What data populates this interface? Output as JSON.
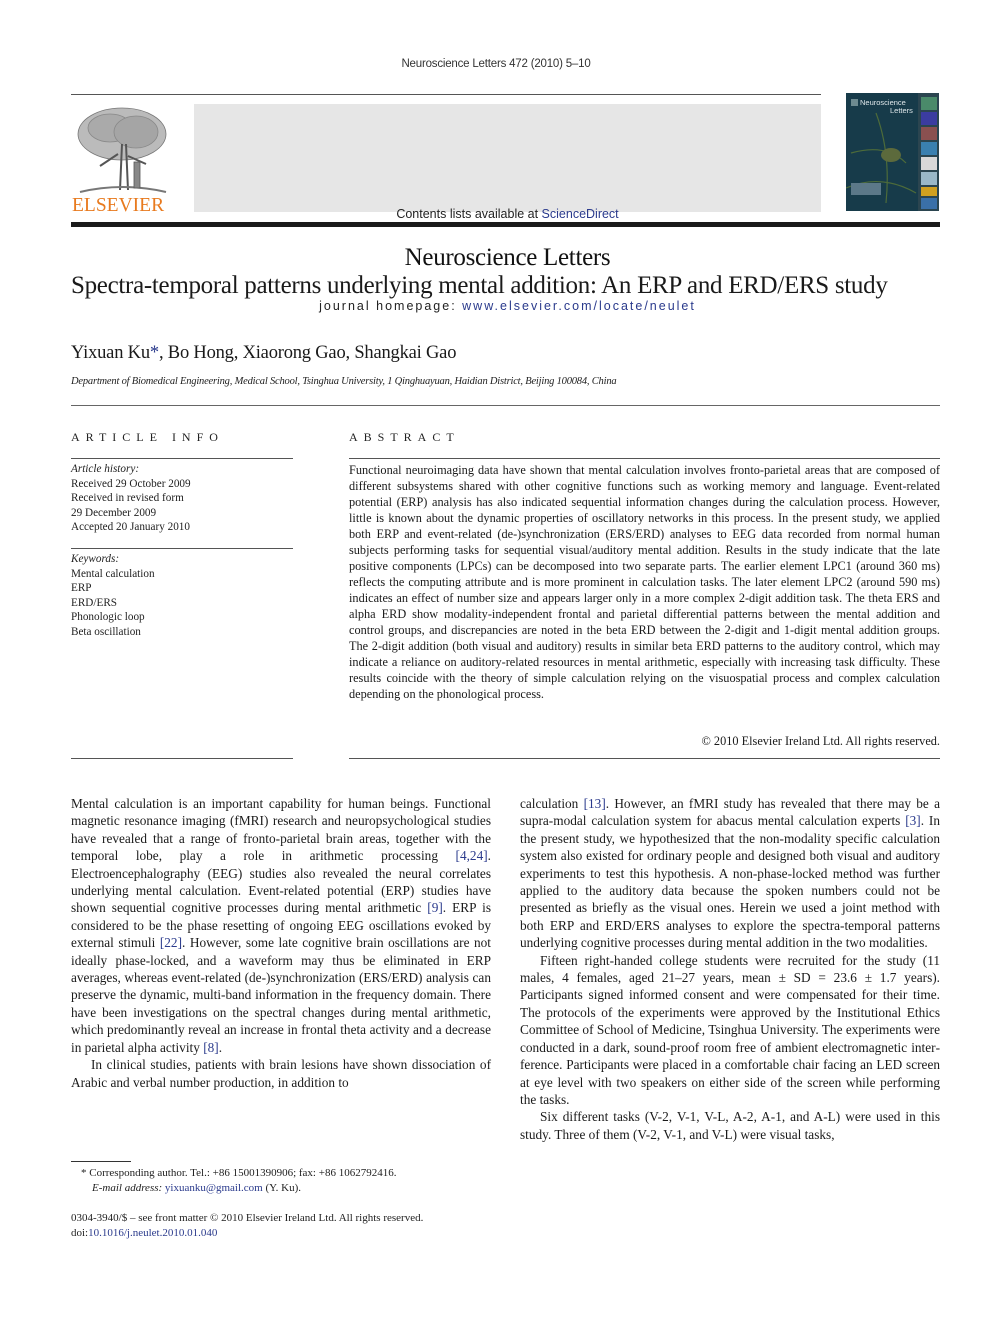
{
  "header": {
    "running_head": "Neuroscience Letters 472 (2010) 5–10",
    "contents_prefix": "Contents lists available at ",
    "contents_link": "ScienceDirect",
    "journal_title": "Neuroscience Letters",
    "homepage_prefix": "journal homepage: ",
    "homepage_link": "www.elsevier.com/locate/neulet",
    "publisher_logo_text": "ELSEVIER",
    "cover_title_line1": "Neuroscience",
    "cover_title_line2": "Letters",
    "colors": {
      "publisher_orange": "#e87a1e",
      "link_blue": "#2a3a8c",
      "band_gray": "#e6e6e6",
      "cover_teal": "#173b4a"
    }
  },
  "article": {
    "title": "Spectra-temporal patterns underlying mental addition: An ERP and ERD/ERS study",
    "authors_before_star": "Yixuan Ku",
    "author_star": "*",
    "authors_after_star": ", Bo Hong, Xiaorong Gao, Shangkai Gao",
    "affiliation": "Department of Biomedical Engineering, Medical School, Tsinghua University, 1 Qinghuayuan, Haidian District, Beijing 100084, China"
  },
  "article_info": {
    "heading": "ARTICLE INFO",
    "history_label": "Article history:",
    "history": [
      "Received 29 October 2009",
      "Received in revised form",
      "29 December 2009",
      "Accepted 20 January 2010"
    ],
    "keywords_label": "Keywords:",
    "keywords": [
      "Mental calculation",
      "ERP",
      "ERD/ERS",
      "Phonologic loop",
      "Beta oscillation"
    ]
  },
  "abstract": {
    "heading": "ABSTRACT",
    "text": "Functional neuroimaging data have shown that mental calculation involves fronto-parietal areas that are composed of different subsystems shared with other cognitive functions such as working memory and language. Event-related potential (ERP) analysis has also indicated sequential information changes during the calculation process. However, little is known about the dynamic properties of oscillatory net­works in this process. In the present study, we applied both ERP and event-related (de-)synchronization (ERS/ERD) analyses to EEG data recorded from normal human subjects performing tasks for sequential visual/auditory mental addition. Results in the study indicate that the late positive components (LPCs) can be decomposed into two separate parts. The earlier element LPC1 (around 360 ms) reflects the com­puting attribute and is more prominent in calculation tasks. The later element LPC2 (around 590 ms) indicates an effect of number size and appears larger only in a more complex 2-digit addition task. The theta ERS and alpha ERD show modality-independent frontal and parietal differential patterns between the mental addition and control groups, and discrepancies are noted in the beta ERD between the 2-digit and 1-digit mental addition groups. The 2-digit addition (both visual and auditory) results in similar beta ERD patterns to the auditory control, which may indicate a reliance on auditory-related resources in men­tal arithmetic, especially with increasing task difficulty. These results coincide with the theory of simple calculation relying on the visuospatial process and complex calculation depending on the phonological process.",
    "copyright": "© 2010 Elsevier Ireland Ltd. All rights reserved."
  },
  "body": {
    "left": {
      "p1": [
        "Mental calculation is an important capability for human beings. Functional magnetic resonance imaging (fMRI) research and neuropsychological studies have revealed that a range of fronto-parietal brain areas, together with the temporal lobe, play a role in arithmetic processing ",
        "[4,24]",
        ". Electroencephalography (EEG) studies also revealed the neural correlates underlying mental calcu­lation. Event-related potential (ERP) studies have shown sequential cognitive processes during mental arithmetic ",
        "[9]",
        ". ERP is con­sidered to be the phase resetting of ongoing EEG oscillations evoked by external stimuli ",
        "[22]",
        ". However, some late cognitive brain oscillations are not ideally phase-locked, and a waveform may thus be eliminated in ERP averages, whereas event-related (de-)synchronization (ERS/ERD) analysis can preserve the dynamic, multi-band information in the frequency domain. There have been investigations on the spectral changes during mental arithmetic, which predominantly reveal an increase in frontal theta activity and a decrease in parietal alpha activity ",
        "[8]",
        "."
      ],
      "p2": "In clinical studies, patients with brain lesions have shown dis­sociation of Arabic and verbal number production, in addition to"
    },
    "right": {
      "p1": [
        "calculation ",
        "[13]",
        ". However, an fMRI study has revealed that there may be a supra-modal calculation system for abacus mental cal­culation experts ",
        "[3]",
        ". In the present study, we hypothesized that the non-modality specific calculation system also existed for ordi­nary people and designed both visual and auditory experiments to test this hypothesis. A non-phase-locked method was further applied to the auditory data because the spoken numbers could not be presented as briefly as the visual ones. Herein we used a joint method with both ERP and ERD/ERS analyses to explore the spectra-temporal patterns underlying cognitive processes during mental addition in the two modalities."
      ],
      "p2": "Fifteen right-handed college students were recruited for the study (11 males, 4 females, aged 21–27 years, mean ± SD = 23.6 ± 1.7 years). Participants signed informed consent and were com­pensated for their time. The protocols of the experiments were approved by the Institutional Ethics Committee of School of Medicine, Tsinghua University. The experiments were conducted in a dark, sound-proof room free of ambient electromagnetic inter­ference. Participants were placed in a comfortable chair facing an LED screen at eye level with two speakers on either side of the screen while performing the tasks.",
      "p3": "Six different tasks (V-2, V-1, V-L, A-2, A-1, and A-L) were used in this study. Three of them (V-2, V-1, and V-L) were visual tasks,"
    }
  },
  "footnote": {
    "star": "*",
    "corresponding": "Corresponding author. Tel.: +86 15001390906; fax: +86 1062792416.",
    "email_label": "E-mail address:",
    "email": "yixuanku@gmail.com",
    "email_suffix": " (Y. Ku)."
  },
  "front_matter": {
    "issn_line": "0304-3940/$ – see front matter © 2010 Elsevier Ireland Ltd. All rights reserved.",
    "doi_prefix": "doi:",
    "doi": "10.1016/j.neulet.2010.01.040"
  }
}
